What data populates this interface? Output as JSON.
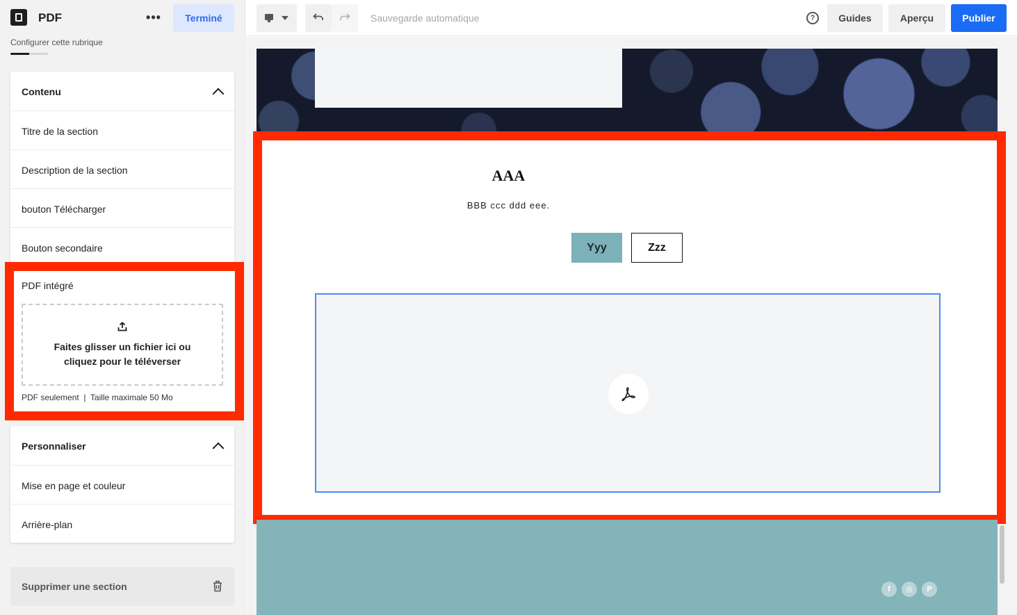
{
  "sidebar": {
    "title": "PDF",
    "more_label": "•••",
    "done_label": "Terminé",
    "subtitle": "Configurer cette rubrique",
    "progress": 0.5,
    "content_panel": {
      "title": "Contenu",
      "items": [
        {
          "label": "Titre de la section"
        },
        {
          "label": "Description de la section"
        },
        {
          "label": "bouton Télécharger"
        },
        {
          "label": "Bouton secondaire"
        }
      ]
    },
    "pdf_embed": {
      "label": "PDF intégré",
      "drop_text": "Faites glisser un fichier ici ou cliquez pour le téléverser",
      "hint": "PDF seulement  |  Taille maximale 50 Mo"
    },
    "customize_panel": {
      "title": "Personnaliser",
      "items": [
        {
          "label": "Mise en page et couleur"
        },
        {
          "label": "Arrière-plan"
        }
      ]
    },
    "delete_label": "Supprimer une section"
  },
  "toolbar": {
    "autosave": "Sauvegarde automatique",
    "help": "?",
    "guides": "Guides",
    "preview": "Aperçu",
    "publish": "Publier"
  },
  "preview": {
    "section_title": "AAA",
    "section_desc": "BBB ccc ddd eee.",
    "primary_button": "Yyy",
    "secondary_button": "Zzz",
    "social": [
      "f",
      "◎",
      "P"
    ]
  },
  "colors": {
    "accent": "#1a6cf5",
    "done_bg": "#dde8ff",
    "highlight": "#ff2a00",
    "button_teal": "#7db1b9",
    "footer": "#82b4ba",
    "pdf_border": "#4d8bf5"
  },
  "icons": [
    "document-icon",
    "more-icon",
    "chevron-up-icon",
    "upload-icon",
    "trash-icon",
    "desktop-icon",
    "dropdown-icon",
    "undo-icon",
    "redo-icon",
    "help-icon",
    "pdf-icon",
    "facebook-icon",
    "instagram-icon",
    "pinterest-icon"
  ]
}
